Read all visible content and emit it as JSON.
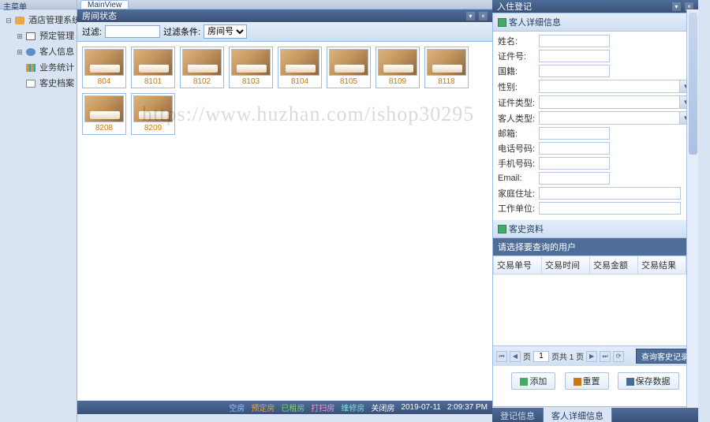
{
  "sidebar": {
    "title": "主菜单",
    "root": "酒店管理系统",
    "items": [
      {
        "label": "预定管理"
      },
      {
        "label": "客人信息"
      },
      {
        "label": "业务统计"
      },
      {
        "label": "客史档案"
      }
    ]
  },
  "mainTab": "MainView",
  "roomPanel": {
    "title": "房间状态",
    "filterLabel": "过滤:",
    "conditionLabel": "过滤条件:",
    "conditionValue": "房间号",
    "rooms": [
      {
        "num": "804"
      },
      {
        "num": "8101"
      },
      {
        "num": "8102"
      },
      {
        "num": "8103"
      },
      {
        "num": "8104"
      },
      {
        "num": "8105"
      },
      {
        "num": "8109"
      },
      {
        "num": "8118"
      },
      {
        "num": "8208"
      },
      {
        "num": "8209"
      }
    ]
  },
  "statusBar": {
    "legends": [
      "空房",
      "预定房",
      "已租房",
      "打扫房",
      "维修房",
      "关闭房"
    ],
    "date": "2019-07-11",
    "time": "2:09:37 PM"
  },
  "rightPanel": {
    "title": "入住登记",
    "detailTitle": "客人详细信息",
    "fields": {
      "name": "姓名:",
      "idno": "证件号:",
      "nation": "国籍:",
      "gender": "性别:",
      "idtype": "证件类型:",
      "guesttype": "客人类型:",
      "email2": "邮箱:",
      "phone": "电话号码:",
      "mobile": "手机号码:",
      "email": "Email:",
      "homeaddr": "家庭住址:",
      "workunit": "工作单位:"
    },
    "historyTitle": "客史资料",
    "historyHint": "请选择要查询的用户",
    "gridCols": [
      "交易单号",
      "交易时间",
      "交易金额",
      "交易结果"
    ],
    "paging": {
      "pageLabel1": "页",
      "pageValue": "1",
      "pageLabel2": "页共 1 页",
      "queryBtn": "查询客史记录"
    },
    "actions": {
      "add": "添加",
      "reset": "重置",
      "save": "保存数据"
    },
    "bottomTabs": [
      "登记信息",
      "客人详细信息"
    ]
  },
  "watermark": "https://www.huzhan.com/ishop30295"
}
